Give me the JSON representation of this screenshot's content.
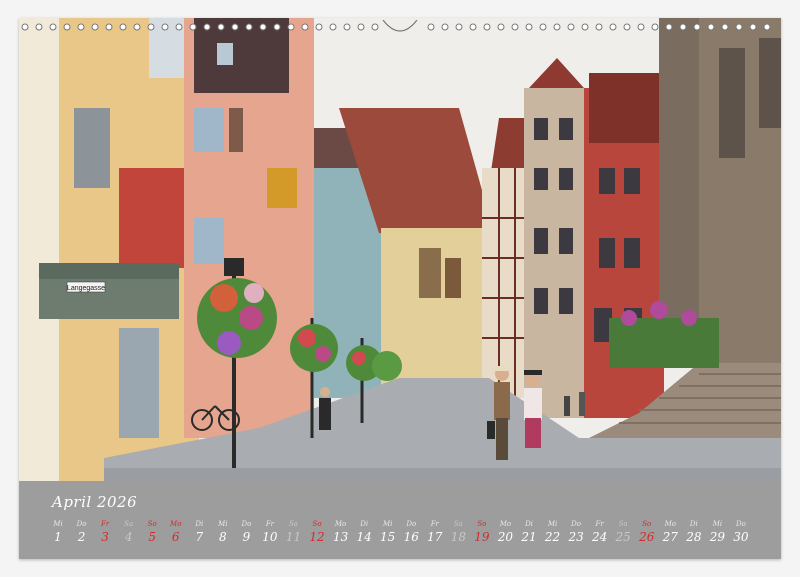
{
  "calendar": {
    "month_label": "April 2026",
    "days": [
      {
        "name": "Mi",
        "num": "1",
        "type": "weekday"
      },
      {
        "name": "Do",
        "num": "2",
        "type": "weekday"
      },
      {
        "name": "Fr",
        "num": "3",
        "type": "holiday"
      },
      {
        "name": "Sa",
        "num": "4",
        "type": "saturday"
      },
      {
        "name": "So",
        "num": "5",
        "type": "sunday"
      },
      {
        "name": "Mo",
        "num": "6",
        "type": "holiday"
      },
      {
        "name": "Di",
        "num": "7",
        "type": "weekday"
      },
      {
        "name": "Mi",
        "num": "8",
        "type": "weekday"
      },
      {
        "name": "Do",
        "num": "9",
        "type": "weekday"
      },
      {
        "name": "Fr",
        "num": "10",
        "type": "weekday"
      },
      {
        "name": "Sa",
        "num": "11",
        "type": "saturday"
      },
      {
        "name": "So",
        "num": "12",
        "type": "sunday"
      },
      {
        "name": "Mo",
        "num": "13",
        "type": "weekday"
      },
      {
        "name": "Di",
        "num": "14",
        "type": "weekday"
      },
      {
        "name": "Mi",
        "num": "15",
        "type": "weekday"
      },
      {
        "name": "Do",
        "num": "16",
        "type": "weekday"
      },
      {
        "name": "Fr",
        "num": "17",
        "type": "weekday"
      },
      {
        "name": "Sa",
        "num": "18",
        "type": "saturday"
      },
      {
        "name": "So",
        "num": "19",
        "type": "sunday"
      },
      {
        "name": "Mo",
        "num": "20",
        "type": "weekday"
      },
      {
        "name": "Di",
        "num": "21",
        "type": "weekday"
      },
      {
        "name": "Mi",
        "num": "22",
        "type": "weekday"
      },
      {
        "name": "Do",
        "num": "23",
        "type": "weekday"
      },
      {
        "name": "Fr",
        "num": "24",
        "type": "weekday"
      },
      {
        "name": "Sa",
        "num": "25",
        "type": "saturday"
      },
      {
        "name": "So",
        "num": "26",
        "type": "sunday"
      },
      {
        "name": "Mo",
        "num": "27",
        "type": "weekday"
      },
      {
        "name": "Di",
        "num": "28",
        "type": "weekday"
      },
      {
        "name": "Mi",
        "num": "29",
        "type": "weekday"
      },
      {
        "name": "Do",
        "num": "30",
        "type": "weekday"
      }
    ]
  },
  "photo": {
    "street_sign": "Langegasse"
  },
  "colors": {
    "strip": "#9d9d9d",
    "sunday": "#d32a2a",
    "text": "#ffffff"
  }
}
